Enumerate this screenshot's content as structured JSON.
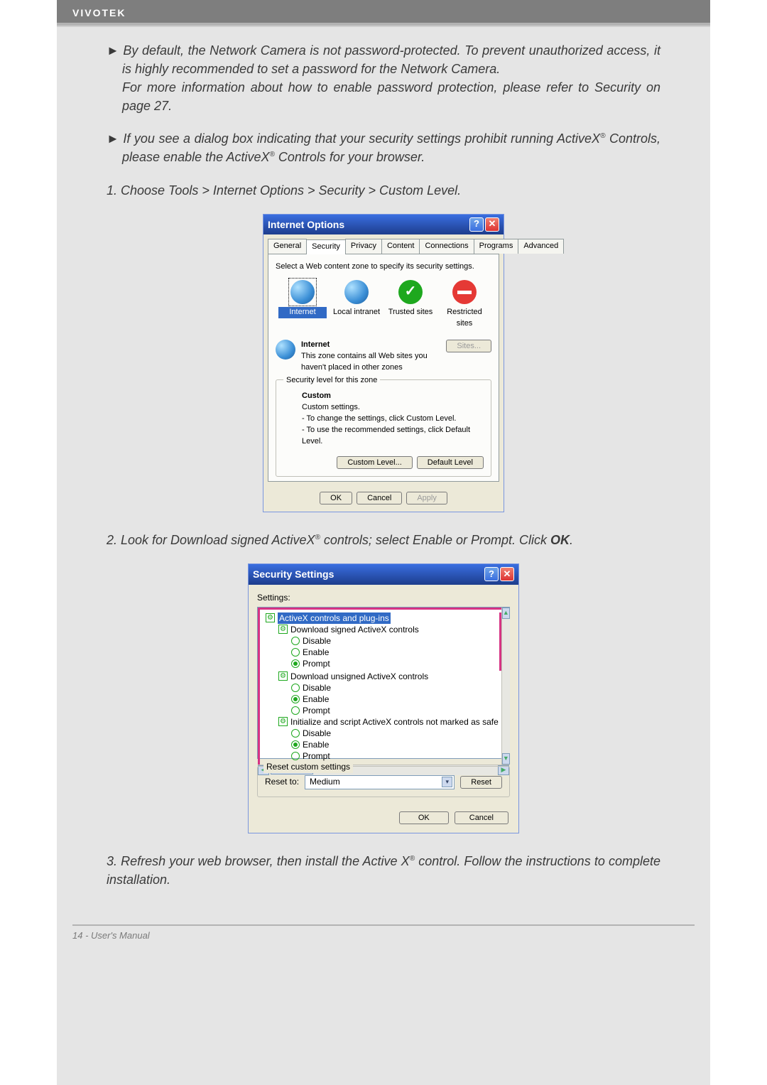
{
  "header": {
    "brand": "VIVOTEK"
  },
  "body": {
    "para1": "► By default, the Network Camera is not password-protected. To prevent unauthorized access, it is highly recommended to set a password for the Network Camera.",
    "para1b": "For more information about how to enable password protection, please refer to Security on page 27.",
    "para2a": "► If you see a dialog box indicating that your security settings prohibit running ActiveX",
    "para2b": " Controls, please enable the ActiveX",
    "para2c": " Controls for your browser.",
    "step1": "1. Choose Tools > Internet Options > Security > Custom Level.",
    "step2a": "2. Look for Download signed ActiveX",
    "step2b": " controls; select Enable or Prompt. Click ",
    "step2c": "OK",
    "step2d": ".",
    "step3a": "3. Refresh your web browser, then install the Active X",
    "step3b": " control. Follow the instructions to complete installation."
  },
  "internet_options": {
    "title": "Internet Options",
    "tabs": [
      "General",
      "Security",
      "Privacy",
      "Content",
      "Connections",
      "Programs",
      "Advanced"
    ],
    "active_tab": 1,
    "prompt": "Select a Web content zone to specify its security settings.",
    "zones": {
      "internet": "Internet",
      "local": "Local intranet",
      "trusted": "Trusted sites",
      "restricted": "Restricted sites"
    },
    "zone_box": {
      "title": "Internet",
      "desc": "This zone contains all Web sites you haven't placed in other zones",
      "sites_btn": "Sites..."
    },
    "level_box": {
      "legend": "Security level for this zone",
      "name": "Custom",
      "line1": "Custom settings.",
      "line2": "- To change the settings, click Custom Level.",
      "line3": "- To use the recommended settings, click Default Level.",
      "custom_btn": "Custom Level...",
      "default_btn": "Default Level"
    },
    "ok": "OK",
    "cancel": "Cancel",
    "apply": "Apply"
  },
  "security_settings": {
    "title": "Security Settings",
    "settings_label": "Settings:",
    "tree": {
      "group": "ActiveX controls and plug-ins",
      "n1": "Download signed ActiveX controls",
      "n2": "Download unsigned ActiveX controls",
      "n3": "Initialize and script ActiveX controls not marked as safe",
      "opt_disable": "Disable",
      "opt_enable": "Enable",
      "opt_prompt": "Prompt"
    },
    "reset": {
      "legend": "Reset custom settings",
      "label": "Reset to:",
      "value": "Medium",
      "btn": "Reset"
    },
    "ok": "OK",
    "cancel": "Cancel"
  },
  "footer": {
    "text": "14 - User's Manual"
  }
}
